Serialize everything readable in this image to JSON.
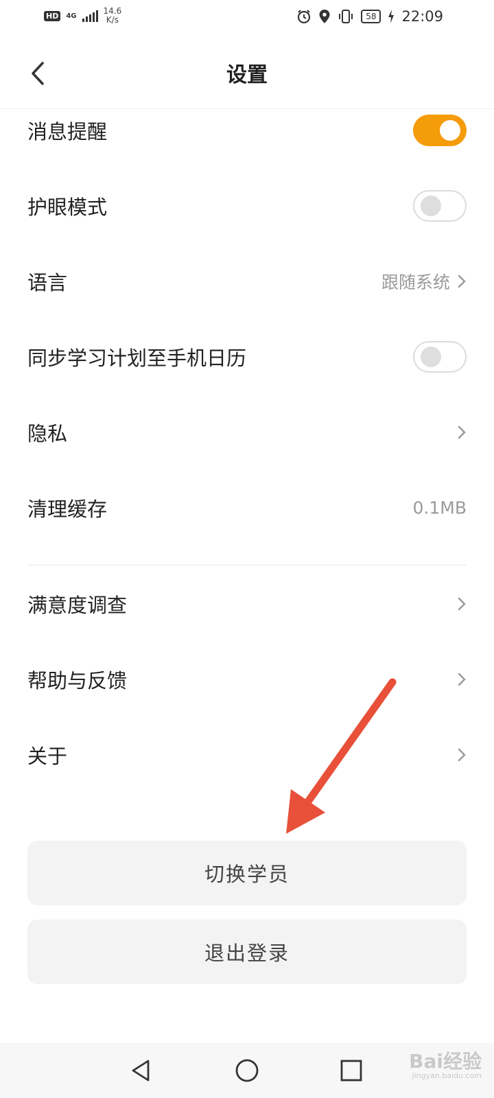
{
  "status_bar": {
    "hd": "HD",
    "network": "4G",
    "speed_value": "14.6",
    "speed_unit": "K/s",
    "battery": "58",
    "time": "22:09",
    "icons": [
      "alarm-icon",
      "location-icon",
      "vibrate-icon",
      "charging-icon"
    ]
  },
  "header": {
    "title": "设置"
  },
  "settings": {
    "notifications": {
      "label": "消息提醒",
      "enabled": true
    },
    "eye_care": {
      "label": "护眼模式",
      "enabled": false
    },
    "language": {
      "label": "语言",
      "value": "跟随系统"
    },
    "calendar_sync": {
      "label": "同步学习计划至手机日历",
      "enabled": false
    },
    "privacy": {
      "label": "隐私"
    },
    "clear_cache": {
      "label": "清理缓存",
      "value": "0.1MB"
    },
    "survey": {
      "label": "满意度调查"
    },
    "help": {
      "label": "帮助与反馈"
    },
    "about": {
      "label": "关于"
    }
  },
  "buttons": {
    "switch_student": "切换学员",
    "logout": "退出登录"
  },
  "watermark": {
    "brand": "Bai经验",
    "url": "jingyan.baidu.com"
  },
  "colors": {
    "accent": "#f59c0b",
    "annotation_arrow": "#e8503a"
  }
}
